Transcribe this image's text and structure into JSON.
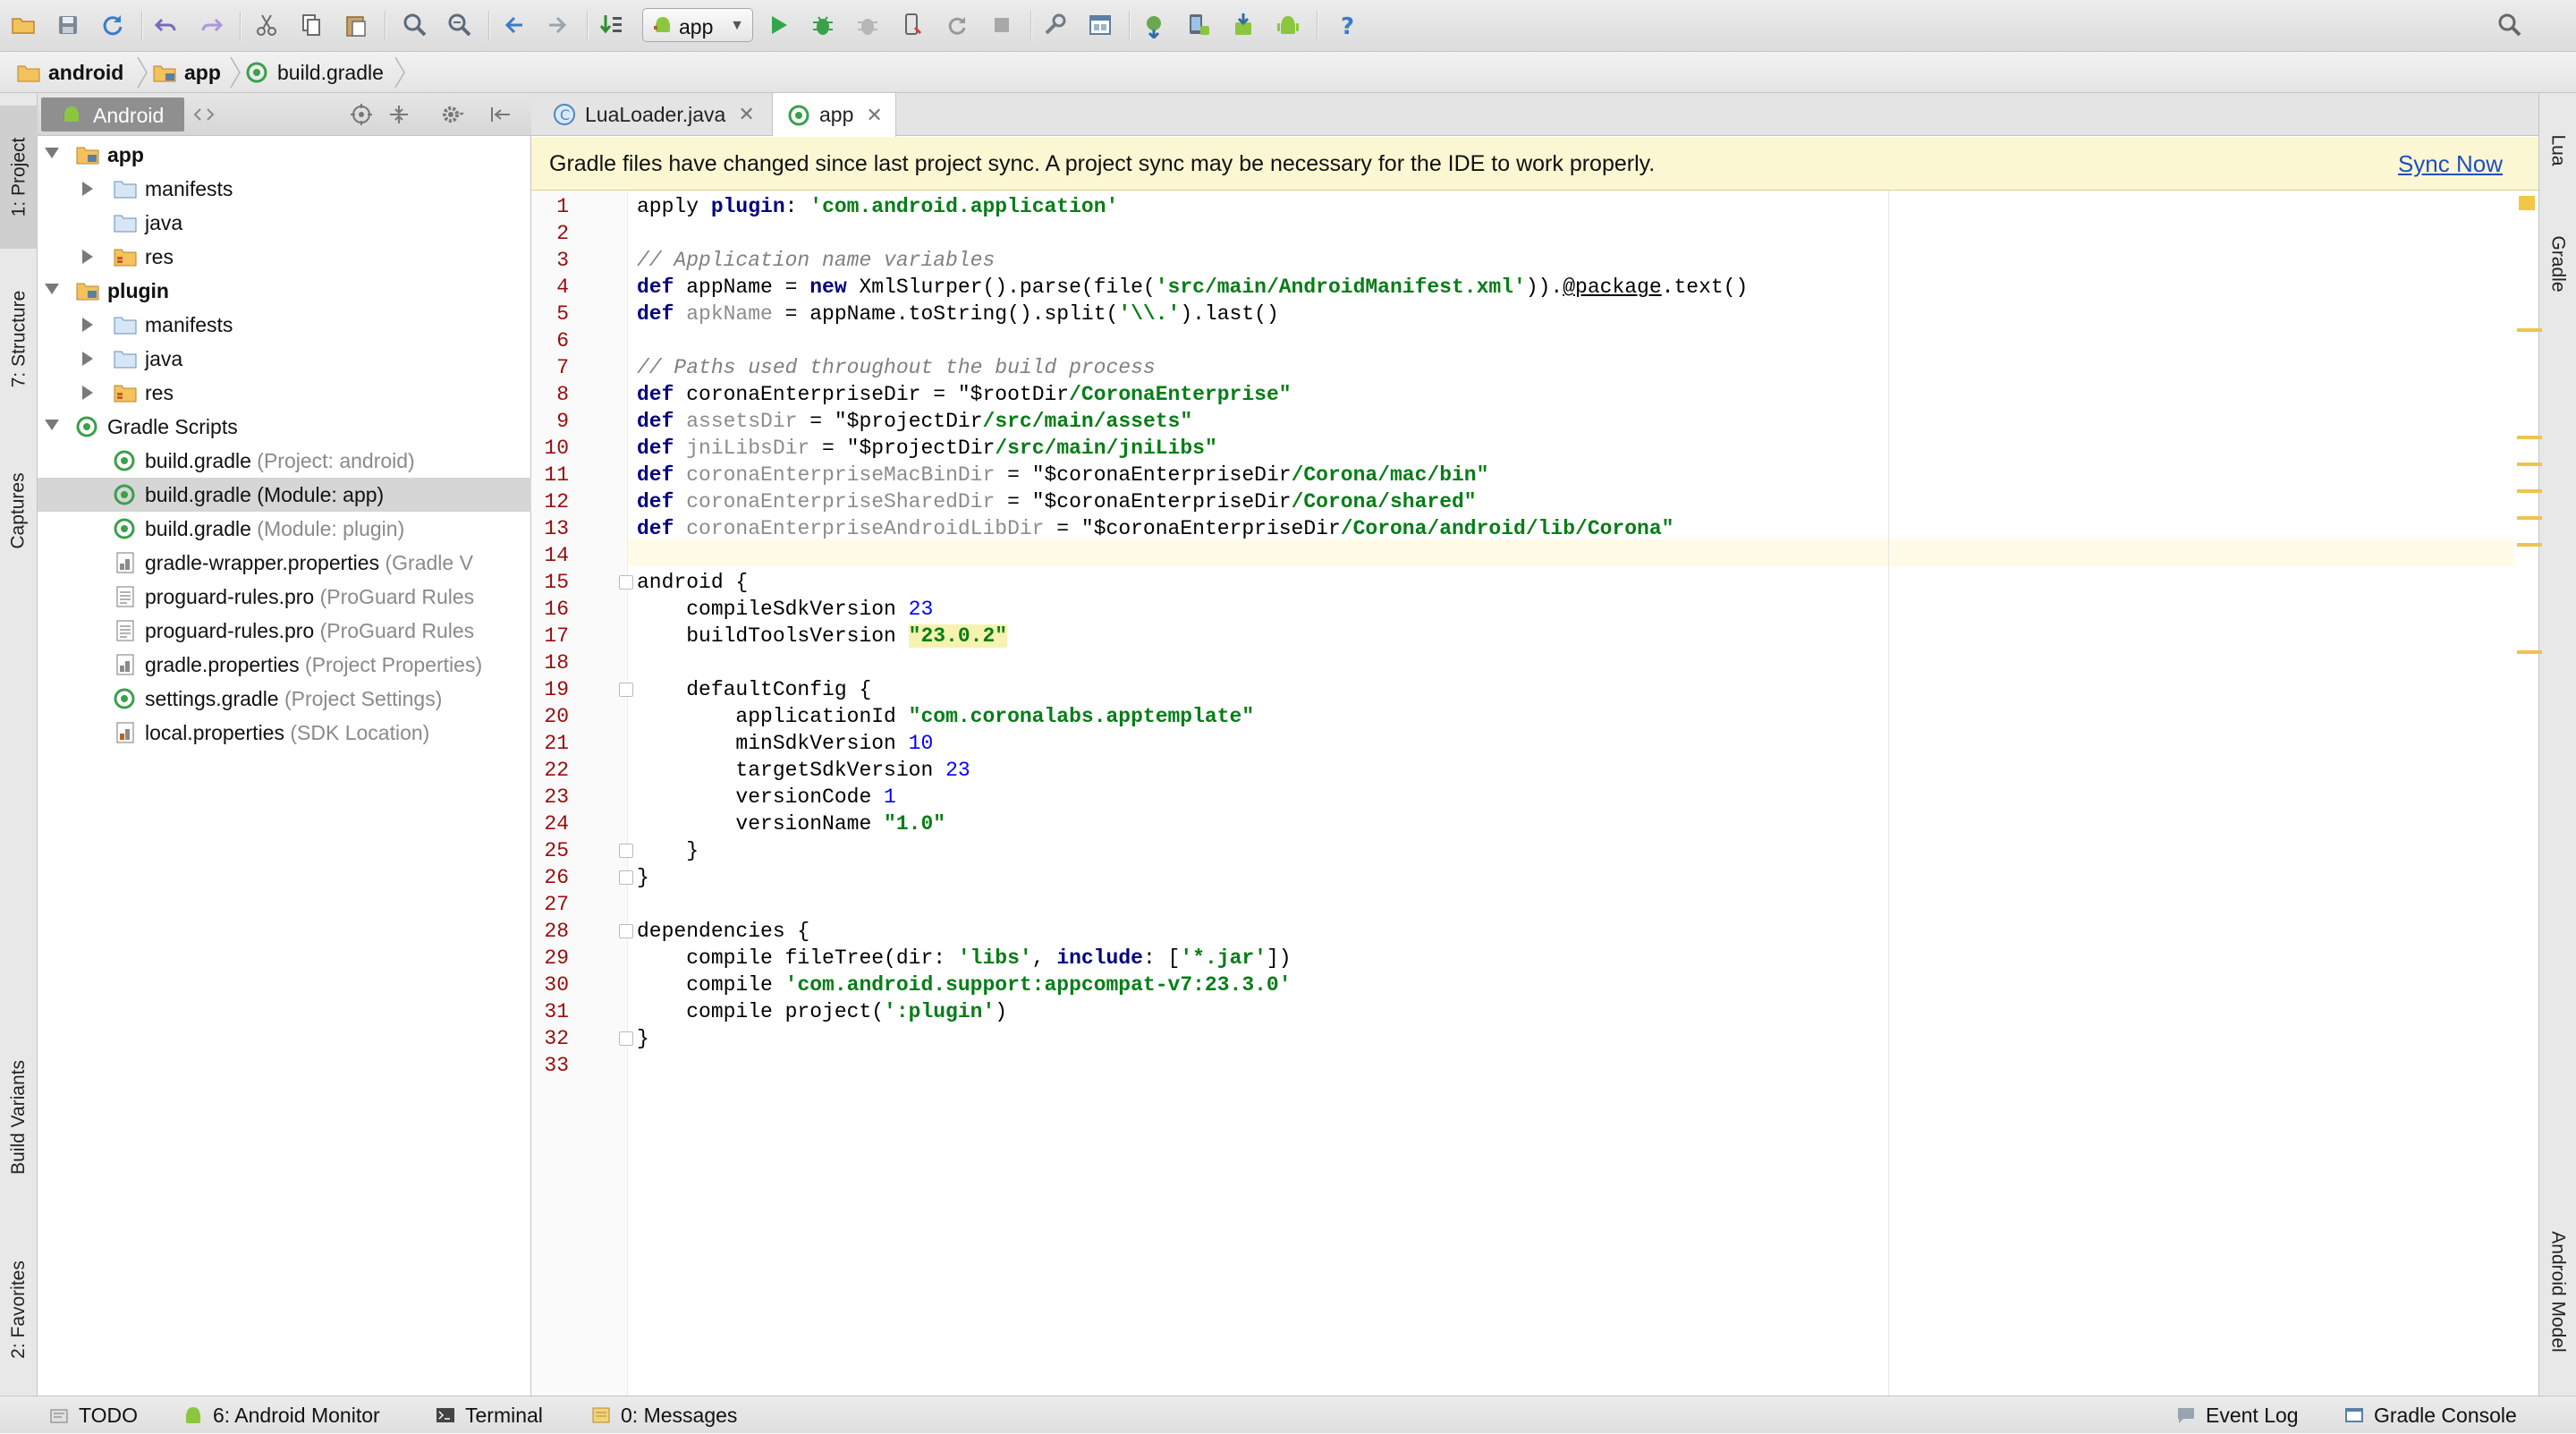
{
  "toolbar": {
    "run_config": "app"
  },
  "breadcrumb": {
    "items": [
      "android",
      "app",
      "build.gradle"
    ]
  },
  "left_tabs": {
    "project": "1: Project",
    "structure": "7: Structure",
    "captures": "Captures",
    "build_variants": "Build Variants",
    "favorites": "2: Favorites"
  },
  "right_tabs": {
    "lua": "Lua",
    "gradle": "Gradle",
    "android_model": "Android Model"
  },
  "project_panel": {
    "view": "Android",
    "tree": [
      {
        "label": "app",
        "hint": ""
      },
      {
        "label": "manifests",
        "hint": ""
      },
      {
        "label": "java",
        "hint": ""
      },
      {
        "label": "res",
        "hint": ""
      },
      {
        "label": "plugin",
        "hint": ""
      },
      {
        "label": "manifests",
        "hint": ""
      },
      {
        "label": "java",
        "hint": ""
      },
      {
        "label": "res",
        "hint": ""
      },
      {
        "label": "Gradle Scripts",
        "hint": ""
      },
      {
        "label": "build.gradle",
        "hint": " (Project: android)"
      },
      {
        "label": "build.gradle",
        "hint": " (Module: app)"
      },
      {
        "label": "build.gradle",
        "hint": " (Module: plugin)"
      },
      {
        "label": "gradle-wrapper.properties",
        "hint": " (Gradle V"
      },
      {
        "label": "proguard-rules.pro",
        "hint": " (ProGuard Rules"
      },
      {
        "label": "proguard-rules.pro",
        "hint": " (ProGuard Rules"
      },
      {
        "label": "gradle.properties",
        "hint": " (Project Properties)"
      },
      {
        "label": "settings.gradle",
        "hint": " (Project Settings)"
      },
      {
        "label": "local.properties",
        "hint": " (SDK Location)"
      }
    ]
  },
  "editor": {
    "tabs": [
      {
        "label": "LuaLoader.java"
      },
      {
        "label": "app"
      }
    ],
    "notification": {
      "message": "Gradle files have changed since last project sync. A project sync may be necessary for the IDE to work properly.",
      "action": "Sync Now"
    },
    "line_numbers": [
      "1",
      "2",
      "3",
      "4",
      "5",
      "6",
      "7",
      "8",
      "9",
      "10",
      "11",
      "12",
      "13",
      "14",
      "15",
      "16",
      "17",
      "18",
      "19",
      "20",
      "21",
      "22",
      "23",
      "24",
      "25",
      "26",
      "27",
      "28",
      "29",
      "30",
      "31",
      "32",
      "33"
    ]
  },
  "status_bar": {
    "todo": "TODO",
    "android_monitor": "6: Android Monitor",
    "terminal": "Terminal",
    "messages": "0: Messages",
    "event_log": "Event Log",
    "gradle_console": "Gradle Console"
  },
  "colors": {
    "keyword": "#000080",
    "string": "#067d17",
    "number": "#0000ff",
    "comment": "#808080",
    "line_number": "#9a0c0c",
    "notification_bg": "#fcf7d3",
    "link": "#1d4fc2",
    "android_green": "#8cc63e"
  }
}
